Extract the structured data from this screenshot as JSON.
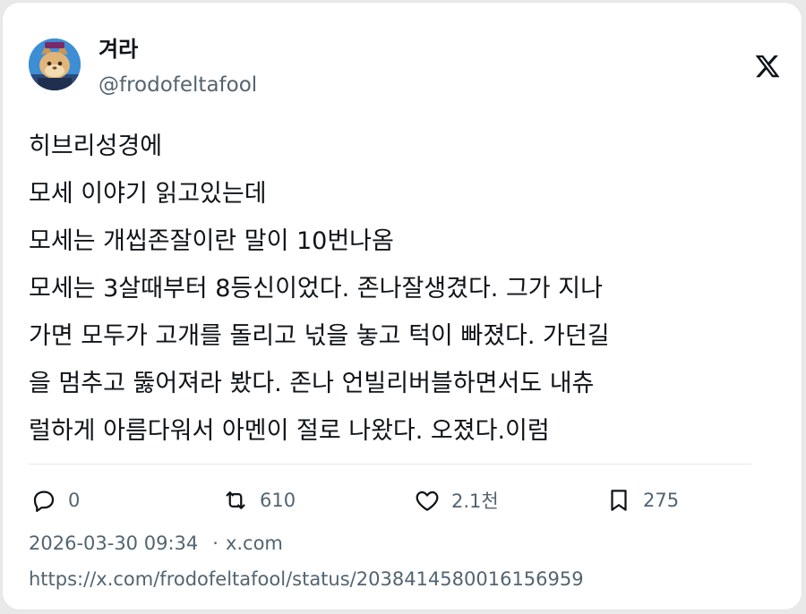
{
  "author": {
    "name": "겨라",
    "handle": "@frodofeltafool"
  },
  "tweet": {
    "lines": [
      "히브리성경에",
      "모세 이야기 읽고있는데",
      "모세는 개씹존잘이란 말이 10번나옴",
      "모세는 3살때부터 8등신이었다. 존나잘생겼다. 그가 지나",
      "가면 모두가 고개를 돌리고 넋을 놓고 턱이 빠졌다. 가던길",
      "을 멈추고 뚫어져라 봤다. 존나 언빌리버블하면서도 내츄",
      "럴하게 아름다워서 아멘이 절로 나왔다. 오졌다.이럼"
    ]
  },
  "stats": {
    "replies": "0",
    "reposts": "610",
    "likes": "2.1천",
    "bookmarks": "275"
  },
  "meta": {
    "datetime": "2026-03-30 09:34",
    "separator": "·",
    "source": "x.com"
  },
  "url": "https://x.com/frodofeltafool/status/2038414580016156959",
  "icons": {
    "brand": "x-logo-icon",
    "reply": "reply-icon",
    "repost": "repost-icon",
    "like": "heart-icon",
    "bookmark": "bookmark-icon"
  },
  "colors": {
    "text": "#0f1419",
    "secondary": "#536471",
    "border": "#e3e5e8"
  }
}
